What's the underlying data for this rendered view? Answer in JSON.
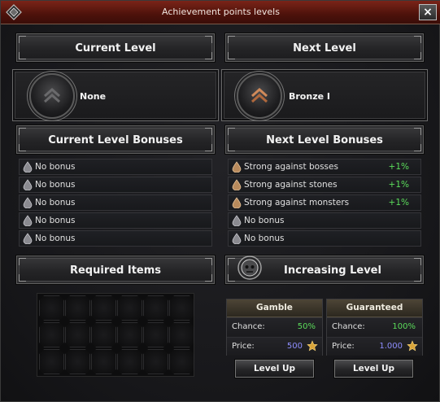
{
  "window": {
    "title": "Achievement points levels",
    "close_label": "×"
  },
  "current": {
    "header": "Current Level",
    "level_name": "None",
    "bonuses_header": "Current Level Bonuses",
    "bonuses": [
      {
        "text": "No bonus",
        "value": ""
      },
      {
        "text": "No bonus",
        "value": ""
      },
      {
        "text": "No bonus",
        "value": ""
      },
      {
        "text": "No bonus",
        "value": ""
      },
      {
        "text": "No bonus",
        "value": ""
      }
    ]
  },
  "next": {
    "header": "Next Level",
    "level_name": "Bronze I",
    "bonuses_header": "Next Level Bonuses",
    "bonuses": [
      {
        "text": "Strong against bosses",
        "value": "+1%"
      },
      {
        "text": "Strong against stones",
        "value": "+1%"
      },
      {
        "text": "Strong against monsters",
        "value": "+1%"
      },
      {
        "text": "No bonus",
        "value": ""
      },
      {
        "text": "No bonus",
        "value": ""
      }
    ]
  },
  "required_items": {
    "header": "Required Items"
  },
  "increasing_level": {
    "header": "Increasing Level",
    "gamble": {
      "title": "Gamble",
      "chance_label": "Chance:",
      "chance_value": "50%",
      "price_label": "Price:",
      "price_value": "500",
      "button": "Level Up"
    },
    "guaranteed": {
      "title": "Guaranteed",
      "chance_label": "Chance:",
      "chance_value": "100%",
      "price_label": "Price:",
      "price_value": "1.000",
      "button": "Level Up"
    }
  },
  "colors": {
    "chance": "#5bdc5b",
    "price": "#8f8fff",
    "bonus_value": "#5bdc5b",
    "titlebar": "#6a1e14"
  },
  "icons": {
    "title": "diamond-emblem-icon",
    "current_level": "chevron-up-icon",
    "next_level": "chevron-up-bronze-icon",
    "bonus": "droplet-icon",
    "price": "star-icon",
    "increasing": "skull-emblem-icon"
  }
}
